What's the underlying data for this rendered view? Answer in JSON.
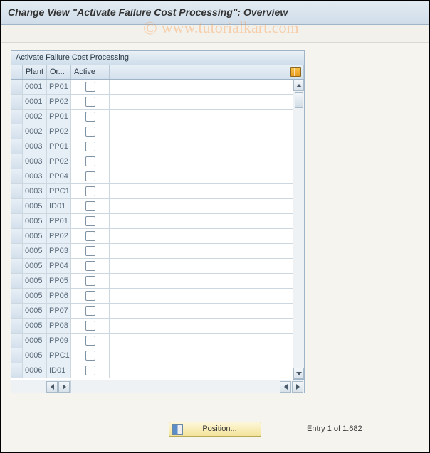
{
  "title": "Change View \"Activate Failure Cost Processing\": Overview",
  "watermark": "www.tutorialkart.com",
  "panel_caption": "Activate Failure Cost Processing",
  "columns": {
    "plant": "Plant",
    "or": "Or...",
    "active": "Active"
  },
  "rows": [
    {
      "plant": "0001",
      "or": "PP01",
      "active": false
    },
    {
      "plant": "0001",
      "or": "PP02",
      "active": false
    },
    {
      "plant": "0002",
      "or": "PP01",
      "active": false
    },
    {
      "plant": "0002",
      "or": "PP02",
      "active": false
    },
    {
      "plant": "0003",
      "or": "PP01",
      "active": false
    },
    {
      "plant": "0003",
      "or": "PP02",
      "active": false
    },
    {
      "plant": "0003",
      "or": "PP04",
      "active": false
    },
    {
      "plant": "0003",
      "or": "PPC1",
      "active": false
    },
    {
      "plant": "0005",
      "or": "ID01",
      "active": false
    },
    {
      "plant": "0005",
      "or": "PP01",
      "active": false
    },
    {
      "plant": "0005",
      "or": "PP02",
      "active": false
    },
    {
      "plant": "0005",
      "or": "PP03",
      "active": false
    },
    {
      "plant": "0005",
      "or": "PP04",
      "active": false
    },
    {
      "plant": "0005",
      "or": "PP05",
      "active": false
    },
    {
      "plant": "0005",
      "or": "PP06",
      "active": false
    },
    {
      "plant": "0005",
      "or": "PP07",
      "active": false
    },
    {
      "plant": "0005",
      "or": "PP08",
      "active": false
    },
    {
      "plant": "0005",
      "or": "PP09",
      "active": false
    },
    {
      "plant": "0005",
      "or": "PPC1",
      "active": false
    },
    {
      "plant": "0006",
      "or": "ID01",
      "active": false
    }
  ],
  "footer": {
    "position_label": "Position...",
    "entry_text": "Entry 1 of 1.682"
  }
}
